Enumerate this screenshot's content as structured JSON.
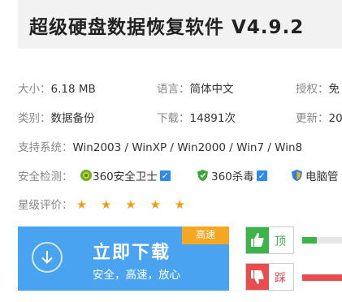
{
  "title": "超级硬盘数据恢复软件 V4.9.2",
  "info": {
    "size_label": "大小：",
    "size_value": "6.18 MB",
    "lang_label": "语言：",
    "lang_value": "简体中文",
    "license_label": "授权：",
    "license_value": "免",
    "category_label": "类别：",
    "category_value": "数据备份",
    "downloads_label": "下载：",
    "downloads_value": "14891次",
    "updated_label": "更新：",
    "updated_value": "20",
    "os_label": "支持系统：",
    "os_value": "Win2003 / WinXP / Win2000 / Win7 / Win8"
  },
  "security": {
    "label": "安全检测：",
    "items": [
      {
        "name": "360安全卫士",
        "icon": "360-guard-icon"
      },
      {
        "name": "360杀毒",
        "icon": "360-antivirus-icon"
      },
      {
        "name": "电脑管",
        "icon": "pc-manager-icon"
      }
    ]
  },
  "rating": {
    "label": "星级评价：",
    "stars": "★ ★ ★ ★ ★",
    "value": 5
  },
  "download": {
    "main": "立即下载",
    "sub": "安全，高速，放心",
    "badge": "高速"
  },
  "votes": {
    "up_label": "顶",
    "down_label": "踩",
    "up_color": "#3bb54a",
    "down_color": "#e84c4c"
  }
}
